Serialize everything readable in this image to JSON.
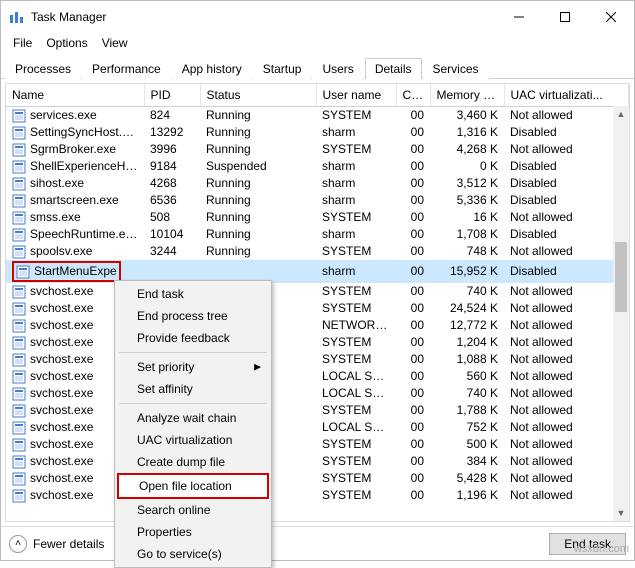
{
  "window": {
    "title": "Task Manager",
    "min_tip": "Minimize",
    "max_tip": "Maximize",
    "close_tip": "Close"
  },
  "menubar": {
    "file": "File",
    "options": "Options",
    "view": "View"
  },
  "tabs": {
    "processes": "Processes",
    "performance": "Performance",
    "app_history": "App history",
    "startup": "Startup",
    "users": "Users",
    "details": "Details",
    "services": "Services"
  },
  "columns": {
    "name": "Name",
    "pid": "PID",
    "status": "Status",
    "user": "User name",
    "cpu": "CPU",
    "mem": "Memory (ac...",
    "uac": "UAC virtualizati..."
  },
  "rows": [
    {
      "name": "services.exe",
      "pid": "824",
      "status": "Running",
      "user": "SYSTEM",
      "cpu": "00",
      "mem": "3,460 K",
      "uac": "Not allowed"
    },
    {
      "name": "SettingSyncHost.exe",
      "pid": "13292",
      "status": "Running",
      "user": "sharm",
      "cpu": "00",
      "mem": "1,316 K",
      "uac": "Disabled"
    },
    {
      "name": "SgrmBroker.exe",
      "pid": "3996",
      "status": "Running",
      "user": "SYSTEM",
      "cpu": "00",
      "mem": "4,268 K",
      "uac": "Not allowed"
    },
    {
      "name": "ShellExperienceHost....",
      "pid": "9184",
      "status": "Suspended",
      "user": "sharm",
      "cpu": "00",
      "mem": "0 K",
      "uac": "Disabled"
    },
    {
      "name": "sihost.exe",
      "pid": "4268",
      "status": "Running",
      "user": "sharm",
      "cpu": "00",
      "mem": "3,512 K",
      "uac": "Disabled"
    },
    {
      "name": "smartscreen.exe",
      "pid": "6536",
      "status": "Running",
      "user": "sharm",
      "cpu": "00",
      "mem": "5,336 K",
      "uac": "Disabled"
    },
    {
      "name": "smss.exe",
      "pid": "508",
      "status": "Running",
      "user": "SYSTEM",
      "cpu": "00",
      "mem": "16 K",
      "uac": "Not allowed"
    },
    {
      "name": "SpeechRuntime.exe",
      "pid": "10104",
      "status": "Running",
      "user": "sharm",
      "cpu": "00",
      "mem": "1,708 K",
      "uac": "Disabled"
    },
    {
      "name": "spoolsv.exe",
      "pid": "3244",
      "status": "Running",
      "user": "SYSTEM",
      "cpu": "00",
      "mem": "748 K",
      "uac": "Not allowed"
    },
    {
      "name": "StartMenuExpe",
      "pid": "",
      "status": "",
      "user": "sharm",
      "cpu": "00",
      "mem": "15,952 K",
      "uac": "Disabled",
      "selected": true,
      "boxed": true
    },
    {
      "name": "svchost.exe",
      "pid": "",
      "status": "",
      "user": "SYSTEM",
      "cpu": "00",
      "mem": "740 K",
      "uac": "Not allowed"
    },
    {
      "name": "svchost.exe",
      "pid": "",
      "status": "",
      "user": "SYSTEM",
      "cpu": "00",
      "mem": "24,524 K",
      "uac": "Not allowed"
    },
    {
      "name": "svchost.exe",
      "pid": "",
      "status": "",
      "user": "NETWORK ...",
      "cpu": "00",
      "mem": "12,772 K",
      "uac": "Not allowed"
    },
    {
      "name": "svchost.exe",
      "pid": "",
      "status": "",
      "user": "SYSTEM",
      "cpu": "00",
      "mem": "1,204 K",
      "uac": "Not allowed"
    },
    {
      "name": "svchost.exe",
      "pid": "",
      "status": "",
      "user": "SYSTEM",
      "cpu": "00",
      "mem": "1,088 K",
      "uac": "Not allowed"
    },
    {
      "name": "svchost.exe",
      "pid": "",
      "status": "",
      "user": "LOCAL SER...",
      "cpu": "00",
      "mem": "560 K",
      "uac": "Not allowed"
    },
    {
      "name": "svchost.exe",
      "pid": "",
      "status": "",
      "user": "LOCAL SER...",
      "cpu": "00",
      "mem": "740 K",
      "uac": "Not allowed"
    },
    {
      "name": "svchost.exe",
      "pid": "",
      "status": "",
      "user": "SYSTEM",
      "cpu": "00",
      "mem": "1,788 K",
      "uac": "Not allowed"
    },
    {
      "name": "svchost.exe",
      "pid": "",
      "status": "",
      "user": "LOCAL SER...",
      "cpu": "00",
      "mem": "752 K",
      "uac": "Not allowed"
    },
    {
      "name": "svchost.exe",
      "pid": "",
      "status": "",
      "user": "SYSTEM",
      "cpu": "00",
      "mem": "500 K",
      "uac": "Not allowed"
    },
    {
      "name": "svchost.exe",
      "pid": "",
      "status": "",
      "user": "SYSTEM",
      "cpu": "00",
      "mem": "384 K",
      "uac": "Not allowed"
    },
    {
      "name": "svchost.exe",
      "pid": "",
      "status": "",
      "user": "SYSTEM",
      "cpu": "00",
      "mem": "5,428 K",
      "uac": "Not allowed"
    },
    {
      "name": "svchost.exe",
      "pid": "",
      "status": "",
      "user": "SYSTEM",
      "cpu": "00",
      "mem": "1,196 K",
      "uac": "Not allowed"
    }
  ],
  "context_menu": {
    "end_task": "End task",
    "end_tree": "End process tree",
    "feedback": "Provide feedback",
    "set_priority": "Set priority",
    "set_affinity": "Set affinity",
    "analyze": "Analyze wait chain",
    "uac": "UAC virtualization",
    "dump": "Create dump file",
    "open_loc": "Open file location",
    "search": "Search online",
    "props": "Properties",
    "services": "Go to service(s)"
  },
  "statusbar": {
    "fewer": "Fewer details",
    "end_task": "End task"
  },
  "watermark": "wsxdn.com"
}
